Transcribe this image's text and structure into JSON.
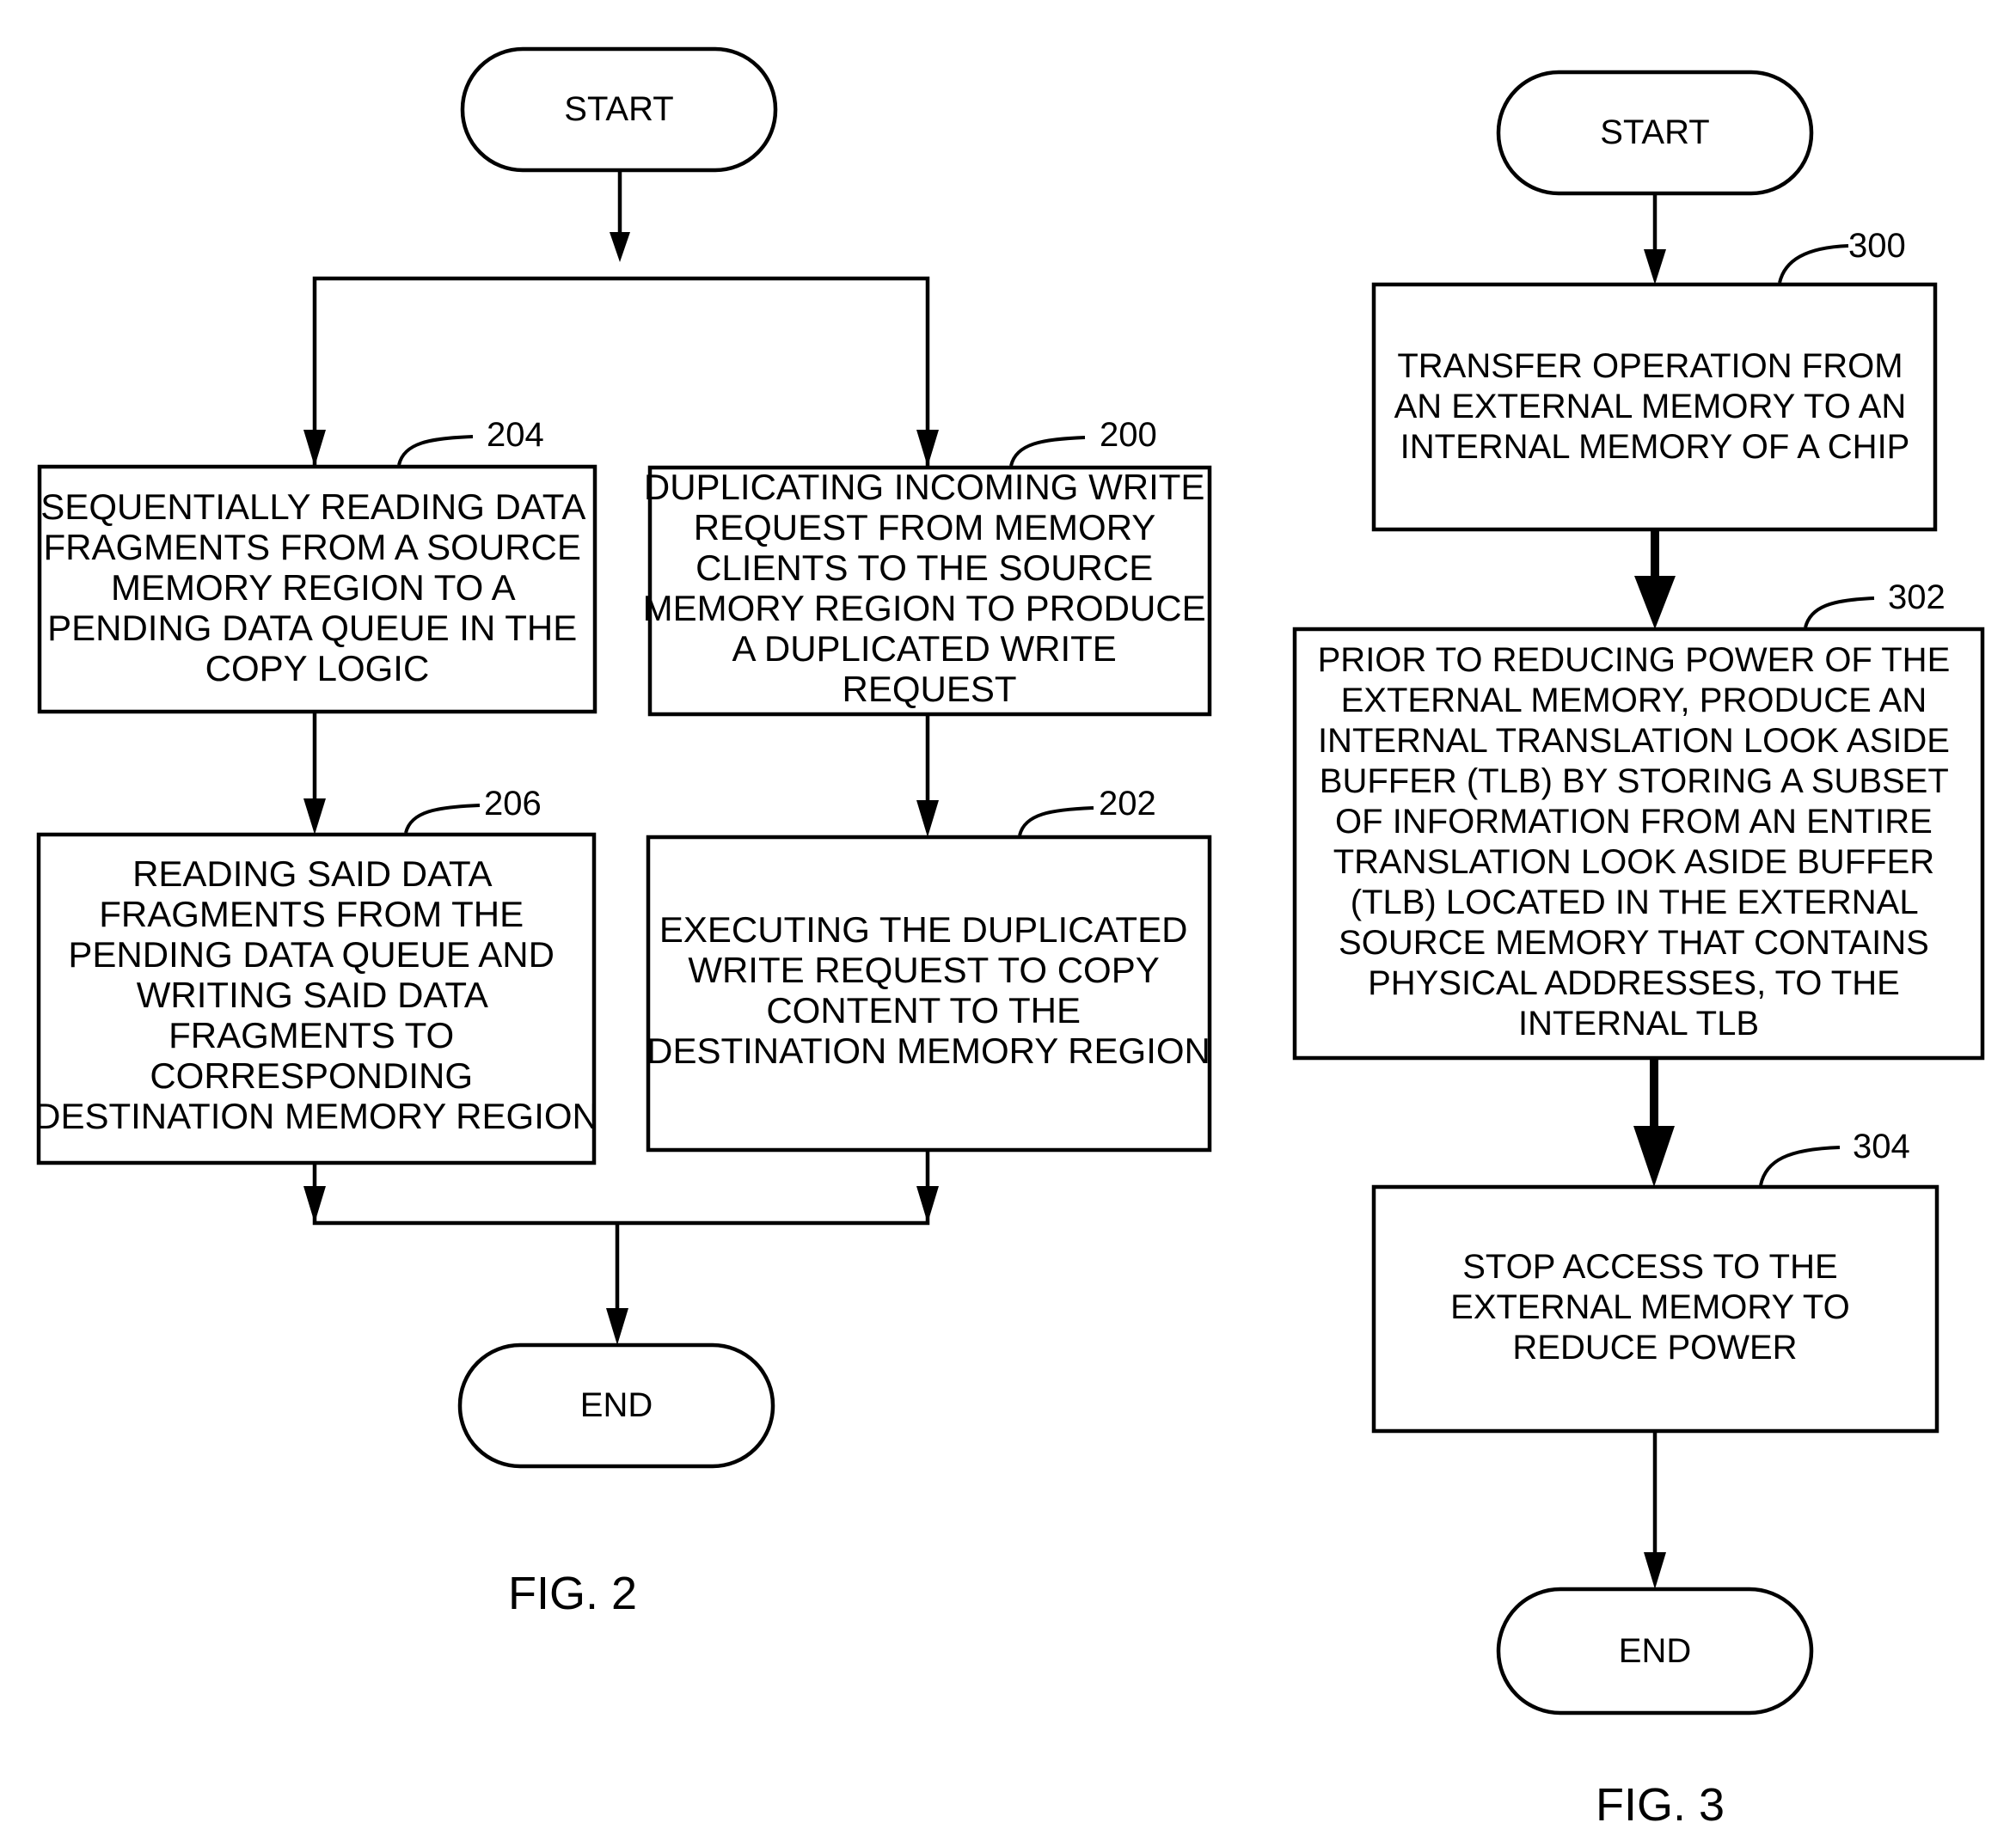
{
  "fig2": {
    "label": "FIG. 2",
    "start": "START",
    "end": "END",
    "steps": [
      {
        "ref": "204",
        "lines": [
          "SEQUENTIALLY READING DATA",
          "FRAGMENTS FROM A SOURCE",
          "MEMORY REGION TO A",
          "PENDING DATA QUEUE IN THE",
          "COPY LOGIC"
        ]
      },
      {
        "ref": "200",
        "lines": [
          "DUPLICATING INCOMING WRITE",
          "REQUEST FROM MEMORY",
          "CLIENTS TO THE SOURCE",
          "MEMORY REGION TO PRODUCE",
          "A DUPLICATED WRITE",
          "REQUEST"
        ]
      },
      {
        "ref": "206",
        "lines": [
          "READING SAID DATA",
          "FRAGMENTS FROM THE",
          "PENDING DATA QUEUE AND",
          "WRITING SAID DATA",
          "FRAGMENTS TO",
          "CORRESPONDING",
          "DESTINATION MEMORY REGION"
        ]
      },
      {
        "ref": "202",
        "lines": [
          "EXECUTING THE DUPLICATED",
          "WRITE REQUEST TO COPY",
          "CONTENT TO THE",
          "DESTINATION MEMORY REGION"
        ]
      }
    ]
  },
  "fig3": {
    "label": "FIG. 3",
    "start": "START",
    "end": "END",
    "steps": [
      {
        "ref": "300",
        "lines": [
          "TRANSFER OPERATION FROM",
          "AN EXTERNAL MEMORY TO AN",
          "INTERNAL MEMORY OF A CHIP"
        ]
      },
      {
        "ref": "302",
        "lines": [
          "PRIOR TO REDUCING POWER OF THE",
          "EXTERNAL MEMORY, PRODUCE AN",
          "INTERNAL TRANSLATION LOOK ASIDE",
          "BUFFER (TLB) BY STORING A SUBSET",
          "OF INFORMATION FROM AN ENTIRE",
          "TRANSLATION LOOK ASIDE BUFFER",
          "(TLB) LOCATED IN THE EXTERNAL",
          "SOURCE MEMORY THAT CONTAINS",
          "PHYSICAL ADDRESSES, TO THE",
          "INTERNAL TLB"
        ]
      },
      {
        "ref": "304",
        "lines": [
          "STOP ACCESS TO THE",
          "EXTERNAL MEMORY TO",
          "REDUCE POWER"
        ]
      }
    ]
  }
}
